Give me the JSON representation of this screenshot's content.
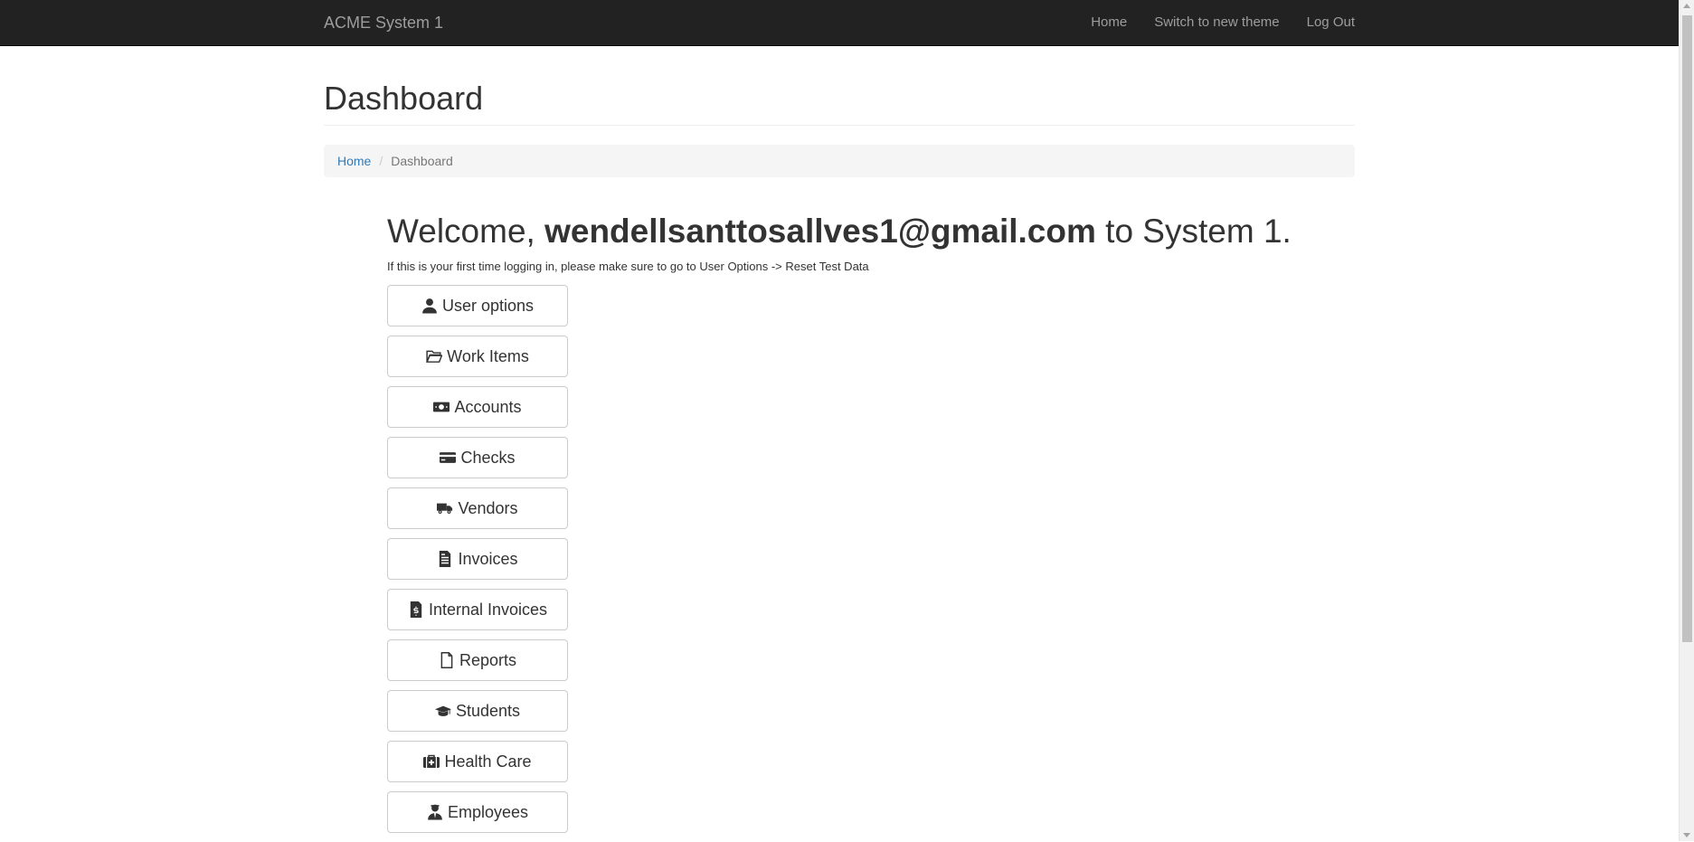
{
  "navbar": {
    "brand": "ACME System 1",
    "links": [
      {
        "label": "Home"
      },
      {
        "label": "Switch to new theme"
      },
      {
        "label": "Log Out"
      }
    ]
  },
  "page": {
    "title": "Dashboard"
  },
  "breadcrumb": {
    "home": "Home",
    "separator": "/",
    "current": "Dashboard"
  },
  "welcome": {
    "prefix": "Welcome,",
    "email": "wendellsanttosallves1@gmail.com",
    "suffix": "to System 1.",
    "note": "If this is your first time logging in, please make sure to go to User Options -> Reset Test Data"
  },
  "menu": [
    {
      "label": "User options",
      "icon": "user-icon"
    },
    {
      "label": "Work Items",
      "icon": "folder-open-icon"
    },
    {
      "label": "Accounts",
      "icon": "money-icon"
    },
    {
      "label": "Checks",
      "icon": "credit-card-icon"
    },
    {
      "label": "Vendors",
      "icon": "truck-icon"
    },
    {
      "label": "Invoices",
      "icon": "file-text-icon"
    },
    {
      "label": "Internal Invoices",
      "icon": "file-invoice-dollar-icon"
    },
    {
      "label": "Reports",
      "icon": "file-icon"
    },
    {
      "label": "Students",
      "icon": "graduation-cap-icon"
    },
    {
      "label": "Health Care",
      "icon": "medkit-icon"
    },
    {
      "label": "Employees",
      "icon": "user-tie-icon"
    }
  ],
  "colors": {
    "navbar_bg": "#222222",
    "navbar_text": "#9d9d9d",
    "link": "#337ab7",
    "breadcrumb_bg": "#f5f5f5"
  }
}
